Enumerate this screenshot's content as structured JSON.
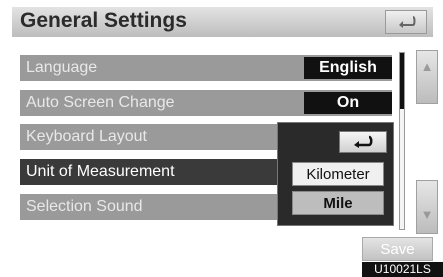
{
  "header": {
    "title": "General Settings"
  },
  "settings": [
    {
      "label": "Language",
      "value": "English"
    },
    {
      "label": "Auto Screen Change",
      "value": "On"
    },
    {
      "label": "Keyboard Layout"
    },
    {
      "label": "Unit of Measurement"
    },
    {
      "label": "Selection Sound"
    }
  ],
  "popup": {
    "options": [
      "Kilometer",
      "Mile"
    ],
    "selected": "Mile"
  },
  "footer": {
    "save_label": "Save",
    "image_code": "U10021LS"
  },
  "icons": {
    "back": "back-arrow-icon",
    "scroll_up": "chevron-up-icon",
    "scroll_down": "chevron-down-icon"
  }
}
